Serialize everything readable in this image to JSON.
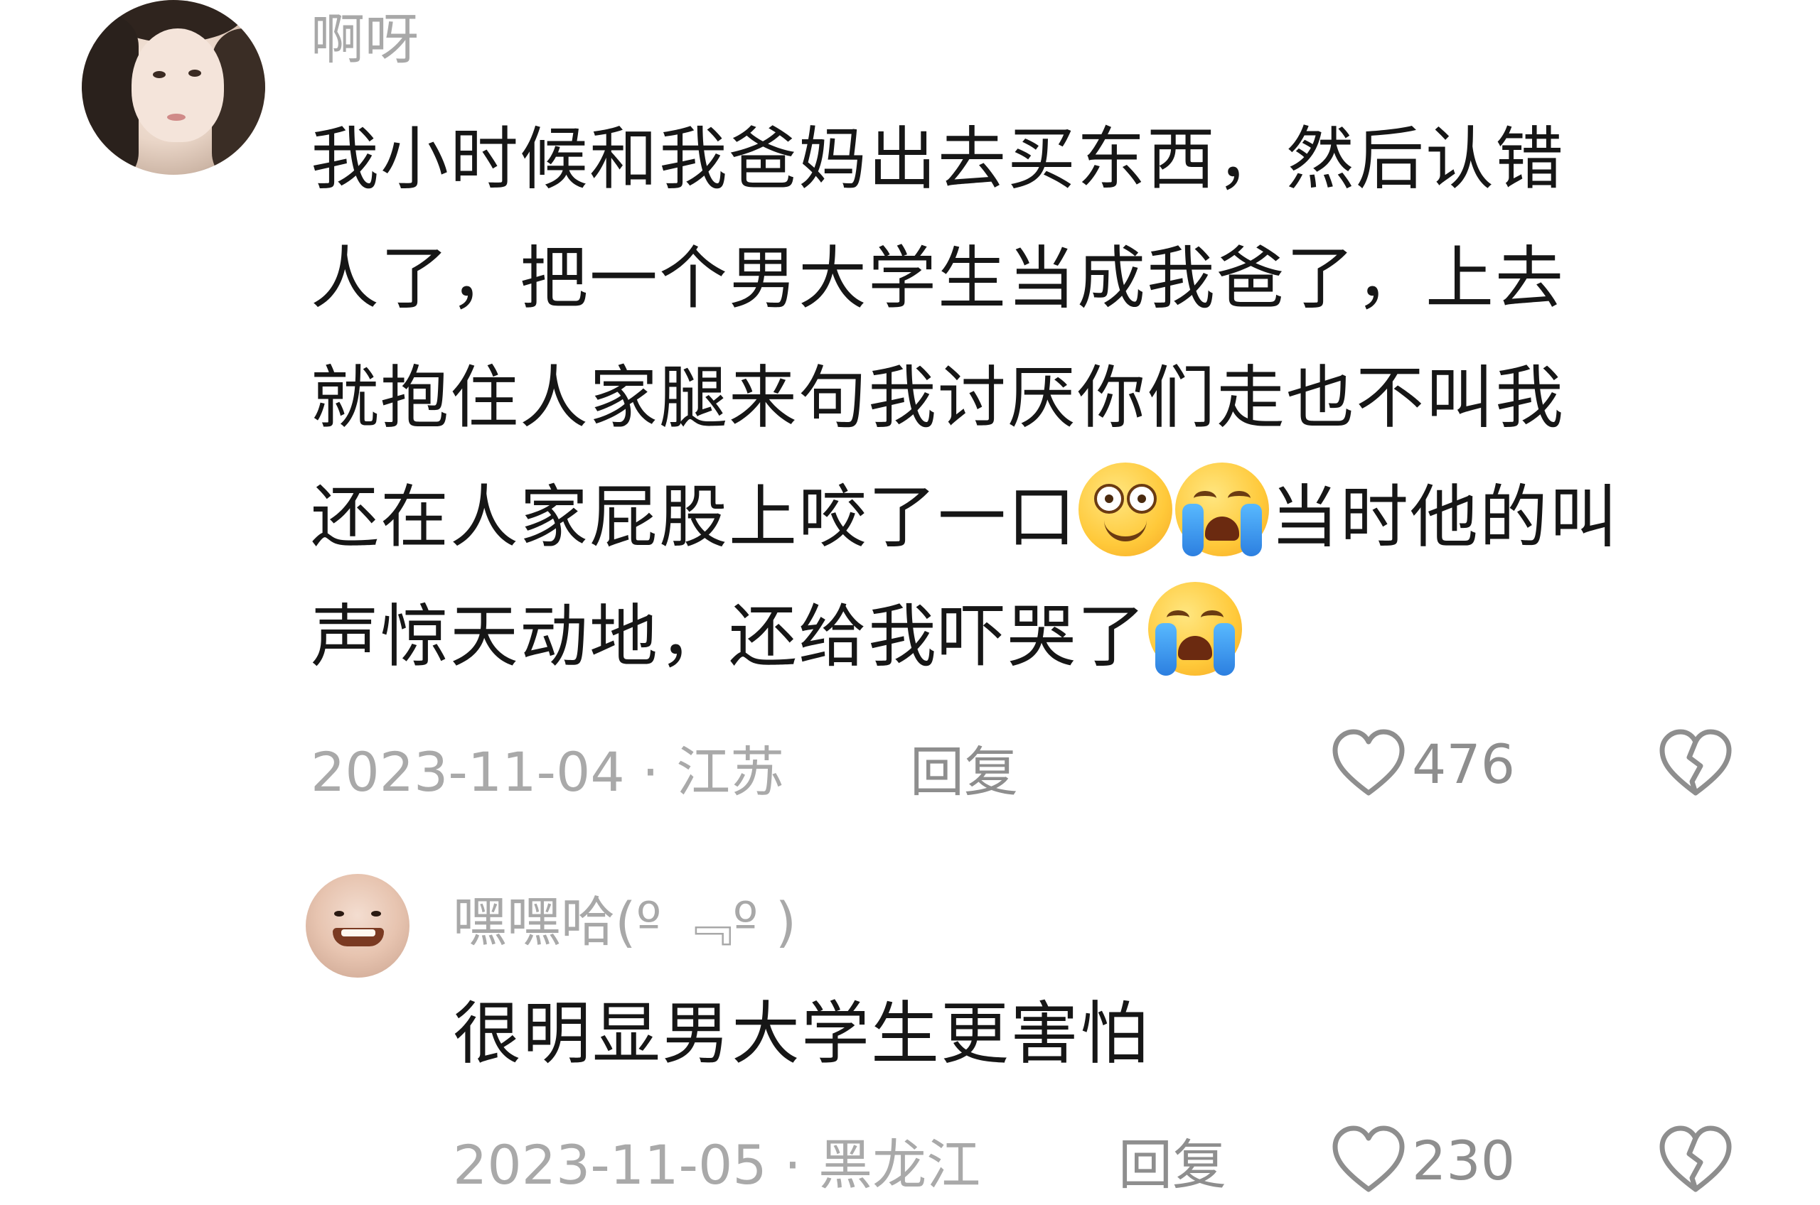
{
  "comments": {
    "main": {
      "username": "啊呀",
      "text_line1": "我小时候和我爸妈出去买东西，然后认错",
      "text_line2": "人了，把一个男大学生当成我爸了，上去",
      "text_line3": "就抱住人家腿来句我讨厌你们走也不叫我",
      "text_line4a": "还在人家屁股上咬了一口",
      "text_line4b": "当时他的叫",
      "text_line5": "声惊天动地，还给我吓哭了",
      "date_location": "2023-11-04 · 江苏",
      "reply_label": "回复",
      "like_count": "476",
      "emojis": [
        "silly-face-emoji",
        "crying-face-emoji",
        "crying-face-emoji"
      ]
    },
    "reply": {
      "username": "嘿嘿哈(º ﹃º )",
      "text": "很明显男大学生更害怕",
      "date_location": "2023-11-05 · 黑龙江",
      "reply_label": "回复",
      "like_count": "230"
    }
  },
  "icons": {
    "like": "heart-outline-icon",
    "dislike": "broken-heart-outline-icon"
  },
  "colors": {
    "text": "#161616",
    "muted": "#a9a9a9",
    "icon": "#8e8e8e",
    "background": "#ffffff"
  }
}
